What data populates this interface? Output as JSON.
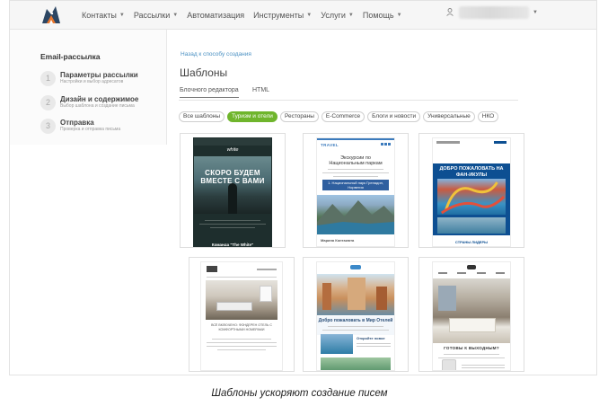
{
  "nav": {
    "items": [
      {
        "label": "Контакты",
        "has_caret": true
      },
      {
        "label": "Рассылки",
        "has_caret": true
      },
      {
        "label": "Автоматизация",
        "has_caret": false
      },
      {
        "label": "Инструменты",
        "has_caret": true
      },
      {
        "label": "Услуги",
        "has_caret": true
      },
      {
        "label": "Помощь",
        "has_caret": true
      }
    ],
    "user_icon": "user-icon"
  },
  "sidebar": {
    "title": "Email-рассылка",
    "steps": [
      {
        "num": "1",
        "title": "Параметры рассылки",
        "subtitle": "Настройки и выбор адресатов"
      },
      {
        "num": "2",
        "title": "Дизайн и содержимое",
        "subtitle": "Выбор шаблона и создание письма"
      },
      {
        "num": "3",
        "title": "Отправка",
        "subtitle": "Проверка и отправка письма"
      }
    ]
  },
  "main": {
    "back_link": "Назад к способу создания",
    "title": "Шаблоны",
    "tabs": [
      {
        "label": "Блочного редактора",
        "active": true
      },
      {
        "label": "HTML",
        "active": false
      }
    ],
    "chips": [
      {
        "label": "Все шаблоны",
        "active": false
      },
      {
        "label": "Туризм и отели",
        "active": true
      },
      {
        "label": "Рестораны",
        "active": false
      },
      {
        "label": "E-Commerce",
        "active": false
      },
      {
        "label": "Блоги и новости",
        "active": false
      },
      {
        "label": "Универсальные",
        "active": false
      },
      {
        "label": "НКО",
        "active": false
      }
    ],
    "templates": [
      {
        "brand": "white",
        "headline": "СКОРО БУДЕМ ВМЕСТЕ С ВАМИ",
        "footer": "Команда \"The White\""
      },
      {
        "brand": "TRAVEL",
        "headline": "Экскурсии по Национальным паркам",
        "subhead": "1. Национальный парк Гренадин, Норвегия",
        "footer": "Марина Контакюта"
      },
      {
        "brand": "",
        "headline": "ДОБРО ПОЖАЛОВАТЬ НА ФАН-ИКУЛЫ",
        "footer": "СТРАНЫ ЛИДЕРЫ"
      },
      {
        "brand": "",
        "headline": "ВСЁ ВКЛЮЧЕНО: ФОНДЕРЕН ОТЕЛЬ С КОМФОРТНЫМИ НОМЕРАМИ",
        "footer": ""
      },
      {
        "brand": "",
        "headline": "Добро пожаловать в Мир Отелей",
        "subhead": "Откройте новое",
        "footer": ""
      },
      {
        "brand": "",
        "headline": "ГОТОВЫ К ВЫХОДНЫМ?",
        "footer": ""
      }
    ]
  },
  "caption": "Шаблоны ускоряют создание писем",
  "colors": {
    "accent_green": "#6fb52c",
    "link_blue": "#4a90c2",
    "ocean_blue": "#0d4f92"
  }
}
